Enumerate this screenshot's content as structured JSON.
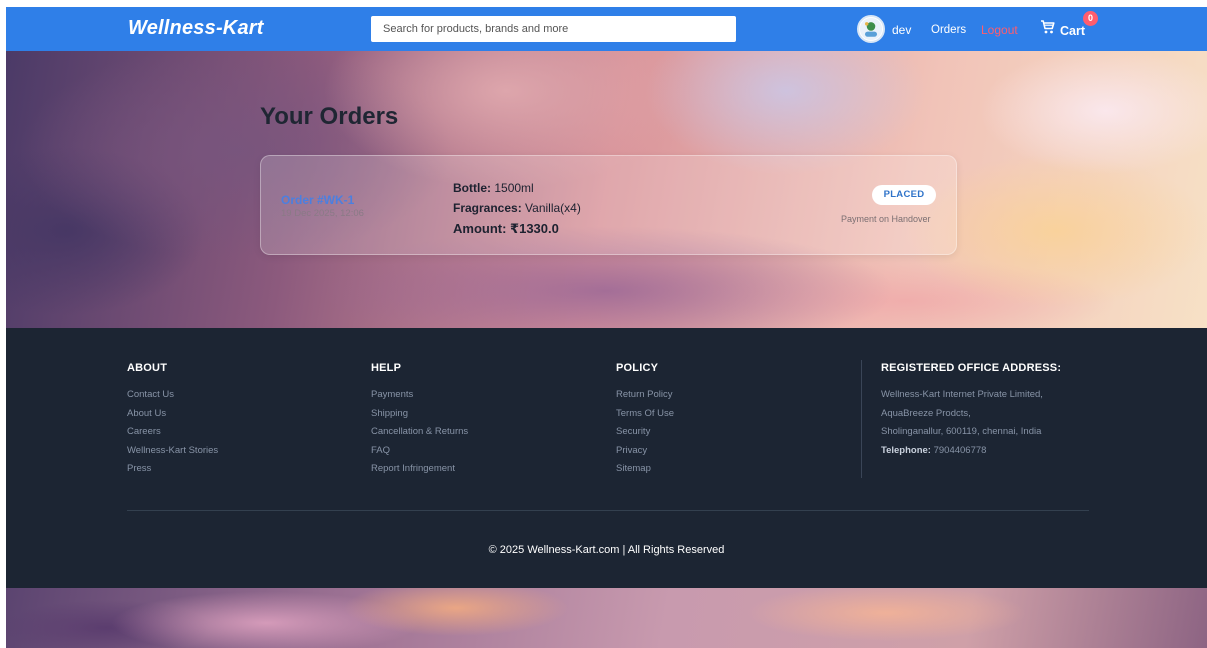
{
  "navbar": {
    "brand": "Wellness-Kart",
    "search_placeholder": "Search for products, brands and more",
    "avatar_icon": "user-avatar-icon",
    "username": "dev",
    "orders_link": "Orders",
    "logout_link": "Logout",
    "cart_label": "Cart",
    "cart_count": "0",
    "cart_icon": "shopping-cart-icon"
  },
  "main": {
    "title": "Your Orders",
    "orders": [
      {
        "id": "Order #WK-1",
        "date": "19 Dec 2025, 12:06",
        "bottle_label": "Bottle:",
        "bottle_value": "1500ml",
        "fragrances_label": "Fragrances:",
        "fragrances_value": "Vanilla(x4)",
        "amount": "Amount: ₹1330.0",
        "status": "PLACED",
        "payment": "Payment on Handover"
      }
    ]
  },
  "footer": {
    "about": {
      "title": "ABOUT",
      "links": [
        "Contact Us",
        "About Us",
        "Careers",
        "Wellness-Kart Stories",
        "Press"
      ]
    },
    "help": {
      "title": "HELP",
      "links": [
        "Payments",
        "Shipping",
        "Cancellation & Returns",
        "FAQ",
        "Report Infringement"
      ]
    },
    "policy": {
      "title": "POLICY",
      "links": [
        "Return Policy",
        "Terms Of Use",
        "Security",
        "Privacy",
        "Sitemap"
      ]
    },
    "address": {
      "title": "REGISTERED OFFICE ADDRESS:",
      "lines": [
        "Wellness-Kart Internet Private Limited,",
        "AquaBreeze Prodcts,",
        "Sholinganallur, 600119, chennai, India"
      ],
      "telephone_label": "Telephone:",
      "telephone": "7904406778"
    },
    "copyright": "© 2025 Wellness-Kart.com | All Rights Reserved"
  },
  "colors": {
    "navbar_bg": "#2f7fe8",
    "footer_bg": "#1c2533",
    "logout": "#ff5d6e",
    "order_link": "#4b7fe0",
    "status_text": "#2f73c9"
  }
}
